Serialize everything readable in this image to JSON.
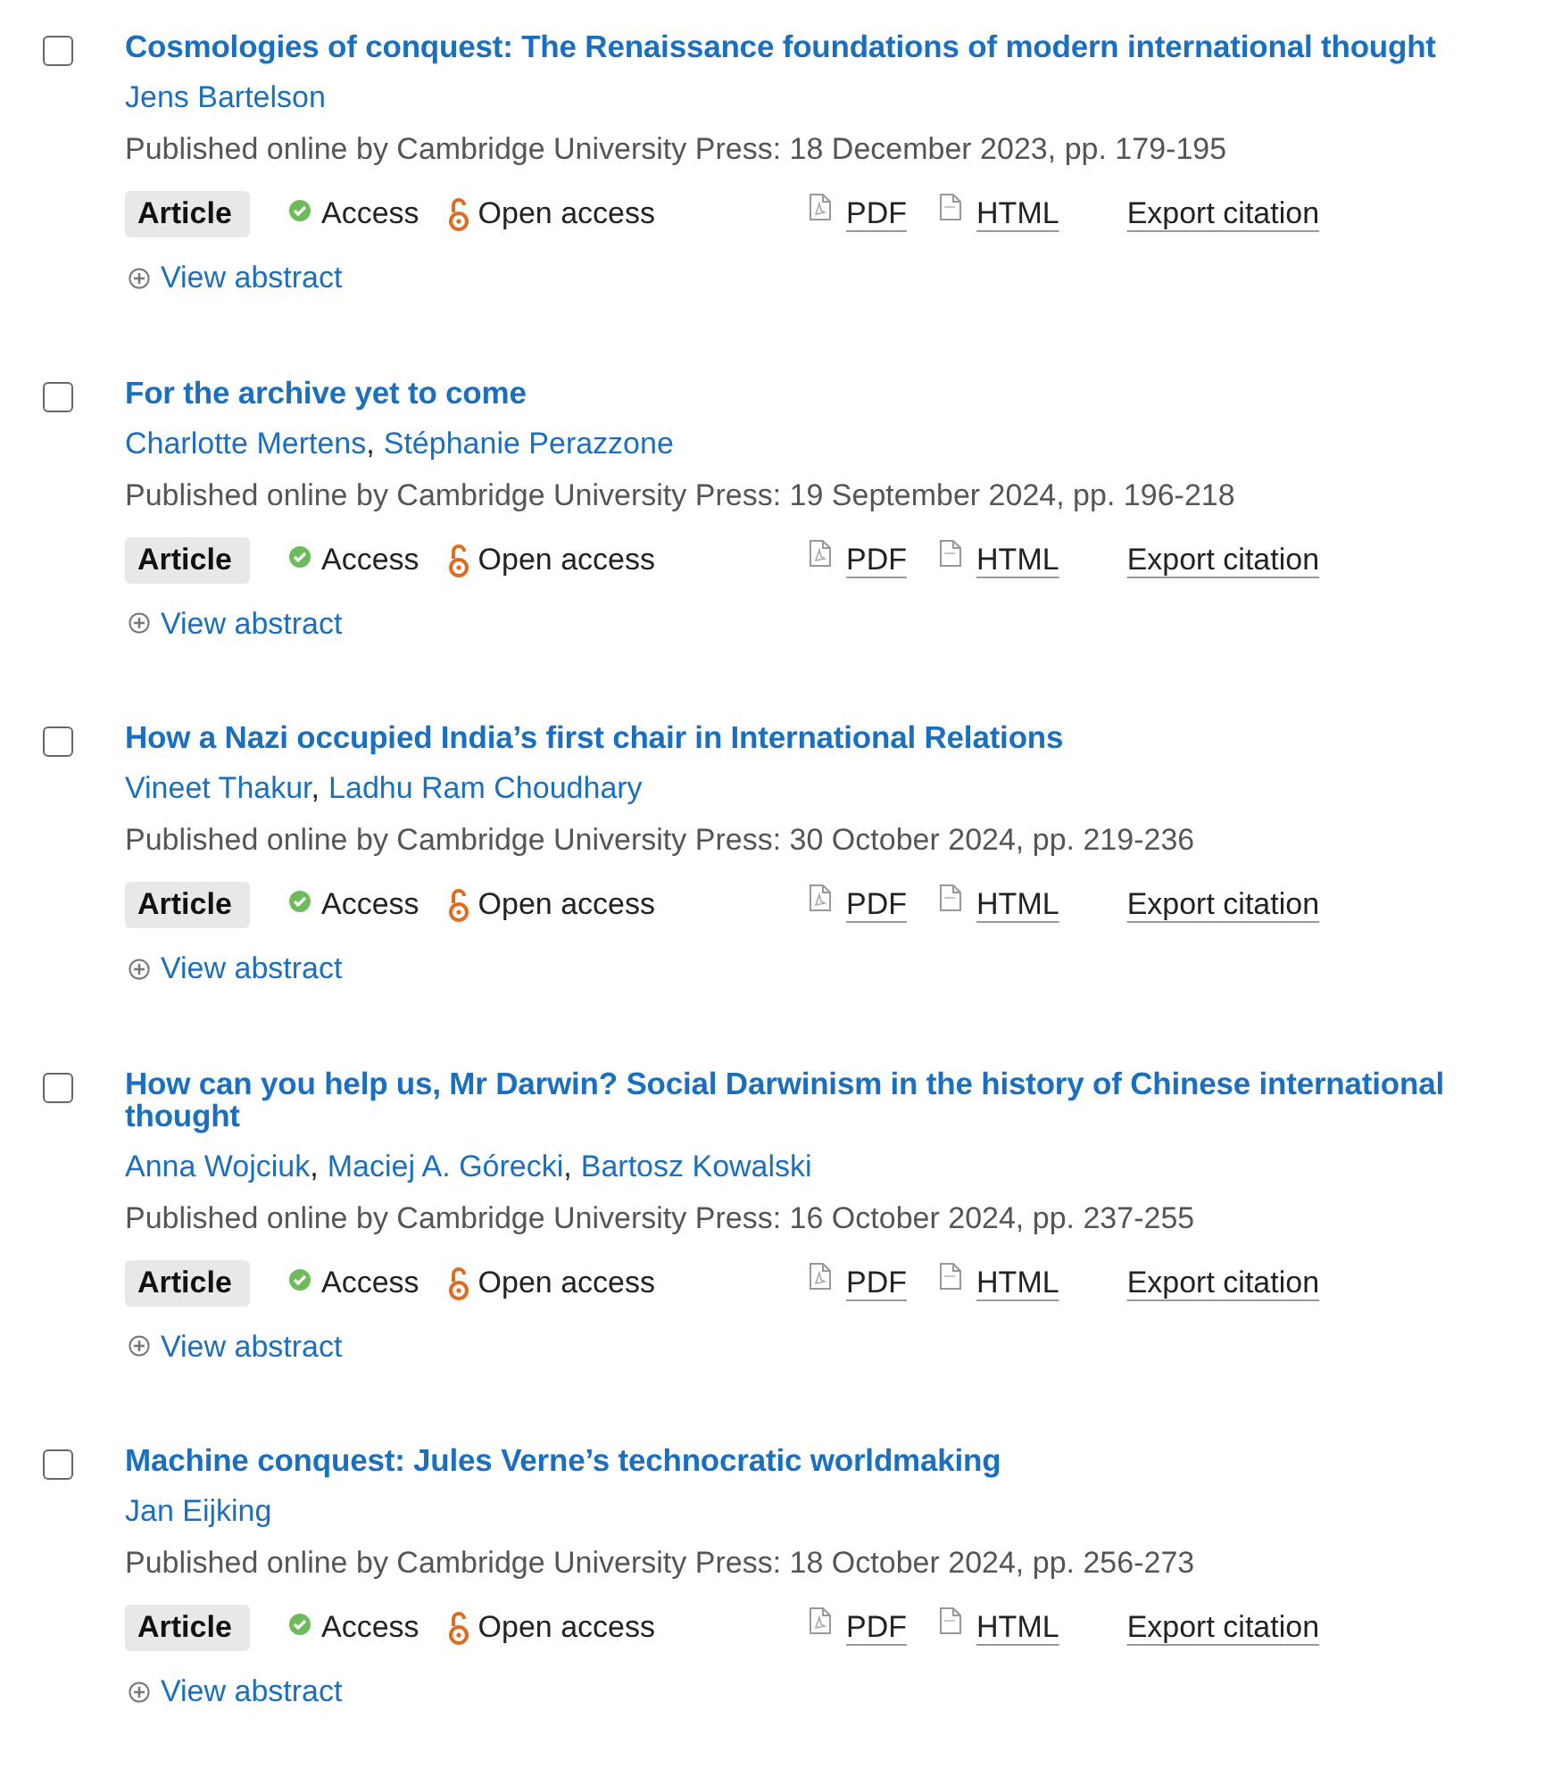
{
  "articles": [
    {
      "checked": false,
      "title": "Cosmologies of conquest: The Renaissance foundations of modern international thought",
      "authors": [
        {
          "name": "Jens Bartelson"
        }
      ],
      "published": "Published online by Cambridge University Press: 18 December 2023, pp. 179-195",
      "type": "Article",
      "access": "Access",
      "open_access": "Open access",
      "links": [
        "PDF",
        "HTML"
      ],
      "export": "Export citation",
      "abstract": "View abstract"
    },
    {
      "checked": false,
      "title": "For the archive yet to come",
      "authors": [
        {
          "name": "Charlotte Mertens",
          "separator": ","
        },
        {
          "name": "Stéphanie Perazzone"
        }
      ],
      "published": "Published online by Cambridge University Press: 19 September 2024, pp. 196-218",
      "type": "Article",
      "access": "Access",
      "open_access": "Open access",
      "links": [
        "PDF",
        "HTML"
      ],
      "export": "Export citation",
      "abstract": "View abstract"
    },
    {
      "checked": false,
      "title": "How a Nazi occupied India’s first chair in International Relations",
      "authors": [
        {
          "name": "Vineet Thakur",
          "separator": ","
        },
        {
          "name": "Ladhu Ram Choudhary"
        }
      ],
      "published": "Published online by Cambridge University Press: 30 October 2024, pp. 219-236",
      "type": "Article",
      "access": "Access",
      "open_access": "Open access",
      "links": [
        "PDF",
        "HTML"
      ],
      "export": "Export citation",
      "abstract": "View abstract"
    },
    {
      "checked": false,
      "title": "How can you help us, Mr Darwin? Social Darwinism in the history of Chinese international thought",
      "authors": [
        {
          "name": "Anna Wojciuk",
          "separator": ","
        },
        {
          "name": "Maciej A. Górecki",
          "separator": ","
        },
        {
          "name": "Bartosz Kowalski"
        }
      ],
      "published": "Published online by Cambridge University Press: 16 October 2024, pp. 237-255",
      "type": "Article",
      "access": "Access",
      "open_access": "Open access",
      "links": [
        "PDF",
        "HTML"
      ],
      "export": "Export citation",
      "abstract": "View abstract"
    },
    {
      "checked": false,
      "title": "Machine conquest: Jules Verne’s technocratic worldmaking",
      "authors": [
        {
          "name": "Jan Eijking"
        }
      ],
      "published": "Published online by Cambridge University Press: 18 October 2024, pp. 256-273",
      "type": "Article",
      "access": "Access",
      "open_access": "Open access",
      "links": [
        "PDF",
        "HTML"
      ],
      "export": "Export citation",
      "abstract": "View abstract"
    }
  ]
}
